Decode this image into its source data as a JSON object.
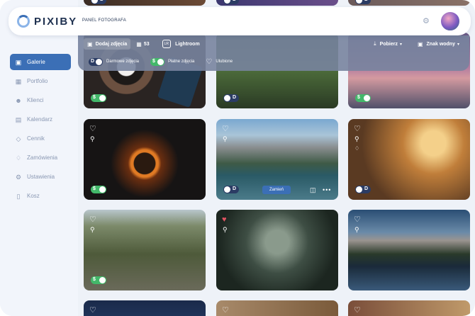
{
  "app": {
    "logo_text": "PIXIBY",
    "panel_title": "PANEL FOTOGRAFA"
  },
  "sidebar": {
    "items": [
      {
        "label": "Galerie",
        "icon": "gallery-icon",
        "active": true
      },
      {
        "label": "Portfolio",
        "icon": "portfolio-icon",
        "active": false
      },
      {
        "label": "Klienci",
        "icon": "clients-icon",
        "active": false
      },
      {
        "label": "Kalendarz",
        "icon": "calendar-icon",
        "active": false
      },
      {
        "label": "Cennik",
        "icon": "price-icon",
        "active": false
      },
      {
        "label": "Zamówienia",
        "icon": "cart-icon",
        "active": false
      },
      {
        "label": "Ustawienia",
        "icon": "gear-icon",
        "active": false
      },
      {
        "label": "Kosz",
        "icon": "trash-icon",
        "active": false
      }
    ]
  },
  "toolbar": {
    "add_label": "Dodaj zdjęcia",
    "photo_count": "53",
    "lr_badge": "LR",
    "lightroom_label": "Lightroom",
    "download_label": "Pobierz",
    "watermark_label": "Znak wodny",
    "toggle_d": "D",
    "toggle_s": "$",
    "free_photos_label": "Darmowe zdjęcia",
    "paid_photos_label": "Płatne zdjęcia",
    "favorites_label": "Ulubione"
  },
  "cards": {
    "toggle_d": "D",
    "toggle_s": "$",
    "select_label": "Zamień"
  },
  "colors": {
    "accent": "#3b6fb6",
    "green": "#43b86a",
    "dark_toggle": "#2b3c64",
    "favorite": "#e25462"
  }
}
